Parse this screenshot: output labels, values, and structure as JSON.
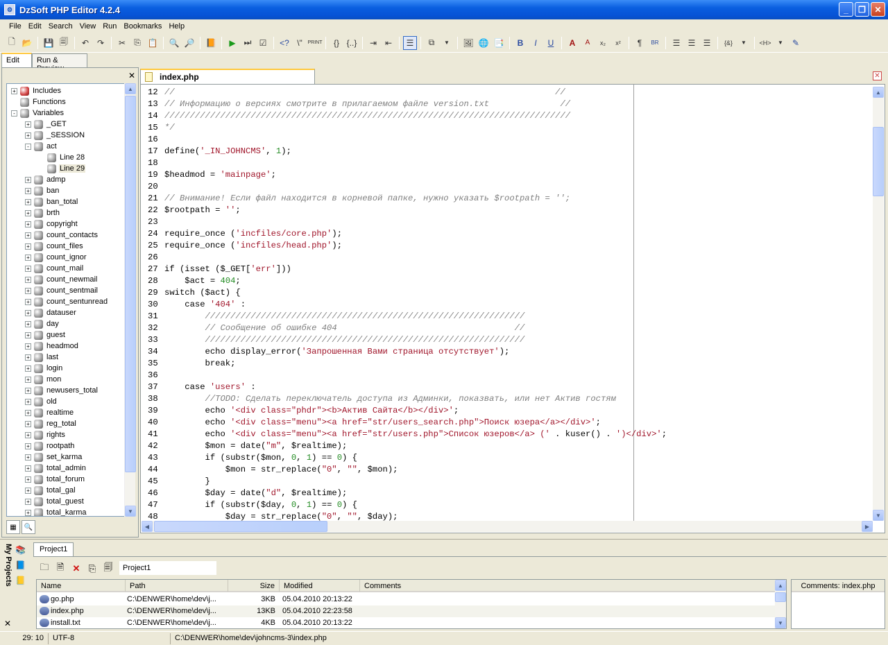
{
  "window": {
    "title": "DzSoft PHP Editor 4.2.4"
  },
  "menu": [
    "File",
    "Edit",
    "Search",
    "View",
    "Run",
    "Bookmarks",
    "Help"
  ],
  "left_tabs": {
    "edit": "Edit",
    "run_preview": "Run & Preview"
  },
  "tree": [
    {
      "label": "Includes",
      "level": 0,
      "expander": "+",
      "icon": "red"
    },
    {
      "label": "Functions",
      "level": 0,
      "expander": "",
      "icon": "gray"
    },
    {
      "label": "Variables",
      "level": 0,
      "expander": "-",
      "icon": "gray"
    },
    {
      "label": "_GET",
      "level": 1,
      "expander": "+",
      "icon": "gray"
    },
    {
      "label": "_SESSION",
      "level": 1,
      "expander": "+",
      "icon": "gray"
    },
    {
      "label": "act",
      "level": 1,
      "expander": "-",
      "icon": "gray"
    },
    {
      "label": "Line 28",
      "level": 2,
      "expander": "",
      "icon": "gray"
    },
    {
      "label": "Line 29",
      "level": 2,
      "expander": "",
      "icon": "gray",
      "selected": true
    },
    {
      "label": "admp",
      "level": 1,
      "expander": "+",
      "icon": "gray"
    },
    {
      "label": "ban",
      "level": 1,
      "expander": "+",
      "icon": "gray"
    },
    {
      "label": "ban_total",
      "level": 1,
      "expander": "+",
      "icon": "gray"
    },
    {
      "label": "brth",
      "level": 1,
      "expander": "+",
      "icon": "gray"
    },
    {
      "label": "copyright",
      "level": 1,
      "expander": "+",
      "icon": "gray"
    },
    {
      "label": "count_contacts",
      "level": 1,
      "expander": "+",
      "icon": "gray"
    },
    {
      "label": "count_files",
      "level": 1,
      "expander": "+",
      "icon": "gray"
    },
    {
      "label": "count_ignor",
      "level": 1,
      "expander": "+",
      "icon": "gray"
    },
    {
      "label": "count_mail",
      "level": 1,
      "expander": "+",
      "icon": "gray"
    },
    {
      "label": "count_newmail",
      "level": 1,
      "expander": "+",
      "icon": "gray"
    },
    {
      "label": "count_sentmail",
      "level": 1,
      "expander": "+",
      "icon": "gray"
    },
    {
      "label": "count_sentunread",
      "level": 1,
      "expander": "+",
      "icon": "gray"
    },
    {
      "label": "datauser",
      "level": 1,
      "expander": "+",
      "icon": "gray"
    },
    {
      "label": "day",
      "level": 1,
      "expander": "+",
      "icon": "gray"
    },
    {
      "label": "guest",
      "level": 1,
      "expander": "+",
      "icon": "gray"
    },
    {
      "label": "headmod",
      "level": 1,
      "expander": "+",
      "icon": "gray"
    },
    {
      "label": "last",
      "level": 1,
      "expander": "+",
      "icon": "gray"
    },
    {
      "label": "login",
      "level": 1,
      "expander": "+",
      "icon": "gray"
    },
    {
      "label": "mon",
      "level": 1,
      "expander": "+",
      "icon": "gray"
    },
    {
      "label": "newusers_total",
      "level": 1,
      "expander": "+",
      "icon": "gray"
    },
    {
      "label": "old",
      "level": 1,
      "expander": "+",
      "icon": "gray"
    },
    {
      "label": "realtime",
      "level": 1,
      "expander": "+",
      "icon": "gray"
    },
    {
      "label": "reg_total",
      "level": 1,
      "expander": "+",
      "icon": "gray"
    },
    {
      "label": "rights",
      "level": 1,
      "expander": "+",
      "icon": "gray"
    },
    {
      "label": "rootpath",
      "level": 1,
      "expander": "+",
      "icon": "gray"
    },
    {
      "label": "set_karma",
      "level": 1,
      "expander": "+",
      "icon": "gray"
    },
    {
      "label": "total_admin",
      "level": 1,
      "expander": "+",
      "icon": "gray"
    },
    {
      "label": "total_forum",
      "level": 1,
      "expander": "+",
      "icon": "gray"
    },
    {
      "label": "total_gal",
      "level": 1,
      "expander": "+",
      "icon": "gray"
    },
    {
      "label": "total_guest",
      "level": 1,
      "expander": "+",
      "icon": "gray"
    },
    {
      "label": "total_karma",
      "level": 1,
      "expander": "+",
      "icon": "gray"
    }
  ],
  "editor": {
    "tab_label": "index.php",
    "lines": [
      {
        "n": "12",
        "segs": [
          [
            "cm",
            "//                                                                           //"
          ]
        ]
      },
      {
        "n": "13",
        "segs": [
          [
            "cm",
            "// Информацию о версиях смотрите в прилагаемом файле version.txt              //"
          ]
        ]
      },
      {
        "n": "14",
        "segs": [
          [
            "cm",
            "////////////////////////////////////////////////////////////////////////////////"
          ]
        ]
      },
      {
        "n": "15",
        "segs": [
          [
            "cm",
            "*/"
          ]
        ]
      },
      {
        "n": "16",
        "segs": []
      },
      {
        "n": "17",
        "segs": [
          [
            "",
            "define("
          ],
          [
            "st",
            "'_IN_JOHNCMS'"
          ],
          [
            "",
            ", "
          ],
          [
            "nm",
            "1"
          ],
          [
            "",
            ");"
          ]
        ]
      },
      {
        "n": "18",
        "segs": []
      },
      {
        "n": "19",
        "segs": [
          [
            "",
            "$headmod = "
          ],
          [
            "st",
            "'mainpage'"
          ],
          [
            "",
            ";"
          ]
        ]
      },
      {
        "n": "20",
        "segs": []
      },
      {
        "n": "21",
        "segs": [
          [
            "cm",
            "// Внимание! Если файл находится в корневой папке, нужно указать $rootpath = '';"
          ]
        ]
      },
      {
        "n": "22",
        "segs": [
          [
            "",
            "$rootpath = "
          ],
          [
            "st",
            "''"
          ],
          [
            "",
            ";"
          ]
        ]
      },
      {
        "n": "23",
        "segs": []
      },
      {
        "n": "24",
        "segs": [
          [
            "",
            "require_once ("
          ],
          [
            "st",
            "'incfiles/core.php'"
          ],
          [
            "",
            ");"
          ]
        ]
      },
      {
        "n": "25",
        "segs": [
          [
            "",
            "require_once ("
          ],
          [
            "st",
            "'incfiles/head.php'"
          ],
          [
            "",
            ");"
          ]
        ]
      },
      {
        "n": "26",
        "segs": []
      },
      {
        "n": "27",
        "segs": [
          [
            "",
            "if (isset ($_GET["
          ],
          [
            "st",
            "'err'"
          ],
          [
            "",
            "]))"
          ]
        ]
      },
      {
        "n": "28",
        "segs": [
          [
            "",
            "    $act = "
          ],
          [
            "nm",
            "404"
          ],
          [
            "",
            ";"
          ]
        ]
      },
      {
        "n": "29",
        "segs": [
          [
            "",
            "switch ($act) {"
          ]
        ]
      },
      {
        "n": "30",
        "segs": [
          [
            "",
            "    case "
          ],
          [
            "st",
            "'404'"
          ],
          [
            "",
            " :"
          ]
        ]
      },
      {
        "n": "31",
        "segs": [
          [
            "cm",
            "        ///////////////////////////////////////////////////////////////"
          ]
        ]
      },
      {
        "n": "32",
        "segs": [
          [
            "cm",
            "        // Сообщение об ошибке 404                                   //"
          ]
        ]
      },
      {
        "n": "33",
        "segs": [
          [
            "cm",
            "        ///////////////////////////////////////////////////////////////"
          ]
        ]
      },
      {
        "n": "34",
        "segs": [
          [
            "",
            "        echo display_error("
          ],
          [
            "st",
            "'Запрошенная Вами страница отсутствует'"
          ],
          [
            "",
            ");"
          ]
        ]
      },
      {
        "n": "35",
        "segs": [
          [
            "",
            "        break;"
          ]
        ]
      },
      {
        "n": "36",
        "segs": []
      },
      {
        "n": "37",
        "segs": [
          [
            "",
            "    case "
          ],
          [
            "st",
            "'users'"
          ],
          [
            "",
            " :"
          ]
        ]
      },
      {
        "n": "38",
        "segs": [
          [
            "cm",
            "        //TODO: Сделать переключатель доступа из Админки, показвать, или нет Актив гостям"
          ]
        ]
      },
      {
        "n": "39",
        "segs": [
          [
            "",
            "        echo "
          ],
          [
            "st",
            "'<div class=\"phdr\"><b>Актив Сайта</b></div>'"
          ],
          [
            "",
            ";"
          ]
        ]
      },
      {
        "n": "40",
        "segs": [
          [
            "",
            "        echo "
          ],
          [
            "st",
            "'<div class=\"menu\"><a href=\"str/users_search.php\">Поиск юзера</a></div>'"
          ],
          [
            "",
            ";"
          ]
        ]
      },
      {
        "n": "41",
        "segs": [
          [
            "",
            "        echo "
          ],
          [
            "st",
            "'<div class=\"menu\"><a href=\"str/users.php\">Список юзеров</a> ('"
          ],
          [
            "",
            " . kuser() . "
          ],
          [
            "st",
            "')</div>'"
          ],
          [
            "",
            ";"
          ]
        ]
      },
      {
        "n": "42",
        "segs": [
          [
            "",
            "        $mon = date("
          ],
          [
            "st",
            "\"m\""
          ],
          [
            "",
            ", $realtime);"
          ]
        ]
      },
      {
        "n": "43",
        "segs": [
          [
            "",
            "        if (substr($mon, "
          ],
          [
            "nm",
            "0"
          ],
          [
            "",
            ", "
          ],
          [
            "nm",
            "1"
          ],
          [
            "",
            ") == "
          ],
          [
            "nm",
            "0"
          ],
          [
            "",
            ") {"
          ]
        ]
      },
      {
        "n": "44",
        "segs": [
          [
            "",
            "            $mon = str_replace("
          ],
          [
            "st",
            "\"0\""
          ],
          [
            "",
            ", "
          ],
          [
            "st",
            "\"\""
          ],
          [
            "",
            ", $mon);"
          ]
        ]
      },
      {
        "n": "45",
        "segs": [
          [
            "",
            "        }"
          ]
        ]
      },
      {
        "n": "46",
        "segs": [
          [
            "",
            "        $day = date("
          ],
          [
            "st",
            "\"d\""
          ],
          [
            "",
            ", $realtime);"
          ]
        ]
      },
      {
        "n": "47",
        "segs": [
          [
            "",
            "        if (substr($day, "
          ],
          [
            "nm",
            "0"
          ],
          [
            "",
            ", "
          ],
          [
            "nm",
            "1"
          ],
          [
            "",
            ") == "
          ],
          [
            "nm",
            "0"
          ],
          [
            "",
            ") {"
          ]
        ]
      },
      {
        "n": "48",
        "segs": [
          [
            "",
            "            $day = str_replace("
          ],
          [
            "st",
            "\"0\""
          ],
          [
            "",
            ", "
          ],
          [
            "st",
            "\"\""
          ],
          [
            "",
            ", $day);"
          ]
        ]
      }
    ]
  },
  "projects": {
    "vertical_label": "My Projects",
    "tab_label": "Project1",
    "project_name": "Project1",
    "columns": [
      "Name",
      "Path",
      "Size",
      "Modified",
      "Comments"
    ],
    "files": [
      {
        "name": "go.php",
        "path": "C:\\DENWER\\home\\dev\\j...",
        "size": "3KB",
        "modified": "05.04.2010 20:13:22"
      },
      {
        "name": "index.php",
        "path": "C:\\DENWER\\home\\dev\\j...",
        "size": "13KB",
        "modified": "05.04.2010 22:23:58"
      },
      {
        "name": "install.txt",
        "path": "C:\\DENWER\\home\\dev\\j...",
        "size": "4KB",
        "modified": "05.04.2010 20:13:22"
      }
    ],
    "comments_header": "Comments: index.php"
  },
  "status": {
    "position": "29:  10",
    "encoding": "UTF-8",
    "path": "C:\\DENWER\\home\\dev\\johncms-3\\index.php"
  }
}
